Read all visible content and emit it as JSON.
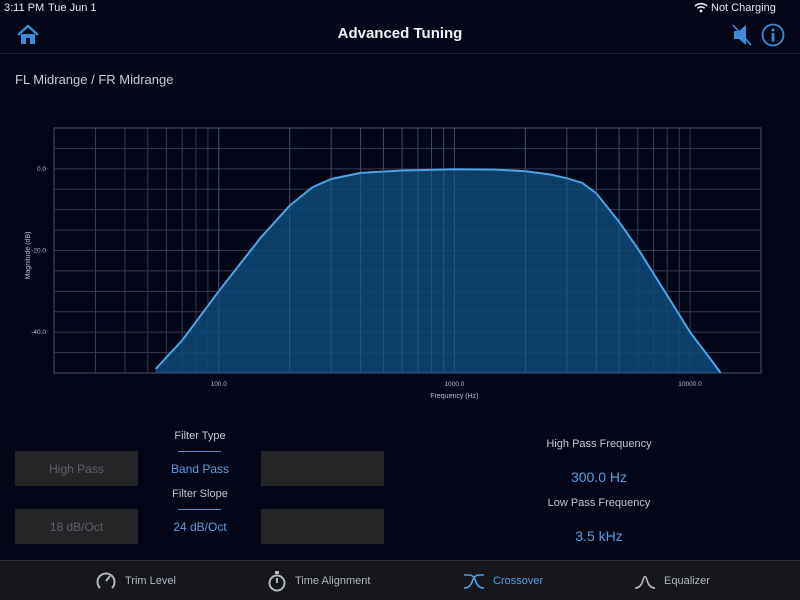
{
  "status_bar": {
    "time": "3:11 PM",
    "date": "Tue Jun 1",
    "charging": "Not Charging"
  },
  "nav": {
    "title": "Advanced Tuning"
  },
  "channel": {
    "title": "FL Midrange / FR Midrange"
  },
  "chart_data": {
    "type": "area",
    "xlabel": "Frequency (Hz)",
    "ylabel": "Magnitude (dB)",
    "x_scale": "log",
    "xlim": [
      20,
      20000
    ],
    "ylim": [
      -50,
      10
    ],
    "x_tick_labels": [
      "100.0",
      "1000.0",
      "10000.0"
    ],
    "y_tick_labels": [
      "0.0",
      "-20.0",
      "-40.0"
    ],
    "grid": true,
    "series": [
      {
        "x": [
          54,
          70,
          100,
          150,
          200,
          250,
          300,
          400,
          600,
          1000,
          1500,
          2000,
          2500,
          3000,
          3500,
          4000,
          5000,
          6000,
          8000,
          10000,
          12000,
          13500
        ],
        "y": [
          -49,
          -42,
          -30,
          -17,
          -9,
          -4.5,
          -2.5,
          -1,
          -0.4,
          -0.1,
          -0.2,
          -0.6,
          -1.3,
          -2.3,
          -3.5,
          -6,
          -13,
          -19.5,
          -31,
          -40,
          -46,
          -50
        ]
      }
    ],
    "colors": {
      "line": "#4aa6e8",
      "fill": "#0d4a78"
    }
  },
  "controls": {
    "filter_type_label": "Filter Type",
    "filter_type_value": "Band Pass",
    "filter_slope_label": "Filter Slope",
    "filter_slope_value": "24 dB/Oct",
    "left_type_button": "High Pass",
    "left_slope_button": "18 dB/Oct",
    "right_type_button": "",
    "right_slope_button": ""
  },
  "frequencies": {
    "high_pass_label": "High Pass Frequency",
    "high_pass_value": "300.0 Hz",
    "low_pass_label": "Low Pass Frequency",
    "low_pass_value": "3.5 kHz"
  },
  "tabs": [
    {
      "label": "Trim Level",
      "icon": "trim-knob-icon"
    },
    {
      "label": "Time Alignment",
      "icon": "stopwatch-icon"
    },
    {
      "label": "Crossover",
      "icon": "crossover-icon"
    },
    {
      "label": "Equalizer",
      "icon": "eq-bell-icon"
    }
  ],
  "colors": {
    "accent": "#4a9fe6",
    "background": "#030617",
    "button": "#252527"
  }
}
